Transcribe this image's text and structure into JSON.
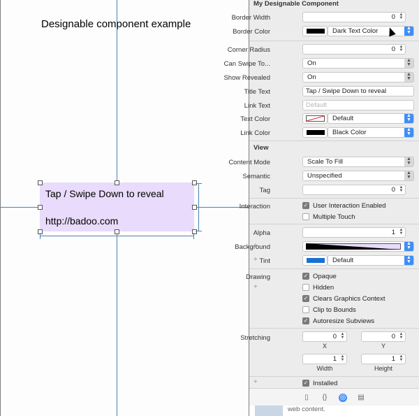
{
  "canvas": {
    "title": "Designable component example",
    "component": {
      "title_text": "Tap / Swipe Down to reveal",
      "link_text": "http://badoo.com"
    }
  },
  "inspector": {
    "designable_section": {
      "title": "My Designable Component",
      "border_width": {
        "label": "Border Width",
        "value": "0"
      },
      "border_color": {
        "label": "Border Color",
        "value": "Dark Text Color"
      },
      "corner_radius": {
        "label": "Corner Radius",
        "value": "0"
      },
      "can_swipe": {
        "label": "Can Swipe To...",
        "value": "On"
      },
      "show_revealed": {
        "label": "Show Revealed",
        "value": "On"
      },
      "title_text": {
        "label": "Title Text",
        "value": "Tap / Swipe Down to reveal"
      },
      "link_text": {
        "label": "Link Text",
        "placeholder": "Default"
      },
      "text_color": {
        "label": "Text Color",
        "value": "Default"
      },
      "link_color": {
        "label": "Link Color",
        "value": "Black Color"
      }
    },
    "view_section": {
      "title": "View",
      "content_mode": {
        "label": "Content Mode",
        "value": "Scale To Fill"
      },
      "semantic": {
        "label": "Semantic",
        "value": "Unspecified"
      },
      "tag": {
        "label": "Tag",
        "value": "0"
      },
      "interaction": {
        "label": "Interaction",
        "user_interaction": "User Interaction Enabled",
        "multiple_touch": "Multiple Touch"
      },
      "alpha": {
        "label": "Alpha",
        "value": "1"
      },
      "background": {
        "label": "Background"
      },
      "tint": {
        "label": "Tint",
        "value": "Default"
      },
      "drawing": {
        "label": "Drawing",
        "opaque": "Opaque",
        "hidden": "Hidden",
        "clears": "Clears Graphics Context",
        "clip": "Clip to Bounds",
        "autoresize": "Autoresize Subviews"
      },
      "stretching": {
        "label": "Stretching",
        "x": "0",
        "y": "0",
        "x_label": "X",
        "y_label": "Y",
        "width": "1",
        "height": "1",
        "width_label": "Width",
        "height_label": "Height"
      },
      "installed": "Installed"
    },
    "web_content": "web content."
  },
  "colors": {
    "component_bg": "#e8dbfb",
    "guide": "#4b82b0",
    "accent": "#3e8ef7",
    "tint_swatch": "#1a6fd6"
  }
}
